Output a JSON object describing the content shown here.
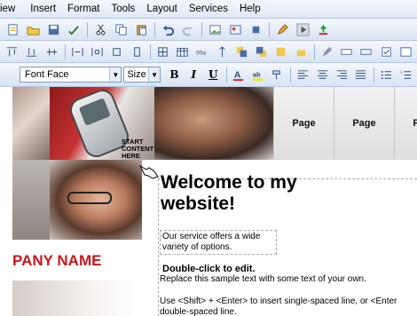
{
  "menu": {
    "items": [
      "iew",
      "Insert",
      "Format",
      "Tools",
      "Layout",
      "Services",
      "Help"
    ]
  },
  "toolbar_format": {
    "font_face": "Font Face",
    "font_size": "Size",
    "bold": "B",
    "italic": "I",
    "underline": "U"
  },
  "page": {
    "nav_tabs": [
      "Page",
      "Page",
      "Page"
    ],
    "start_label": "START CONTENT HERE",
    "welcome_title": "Welcome to my website!",
    "intro_text": "Our service offers a wide variety of options.",
    "edit_title": "Double-click to edit.",
    "edit_text": "Replace this sample text with some text of your own.",
    "hint_line1": "Use <Shift> + <Enter> to insert single-spaced line, or <Enter",
    "hint_line2": "double-spaced line.",
    "company_name": "PANY NAME"
  },
  "colors": {
    "accent": "#c8161d",
    "toolbar_bg": "#dfe8f6"
  }
}
